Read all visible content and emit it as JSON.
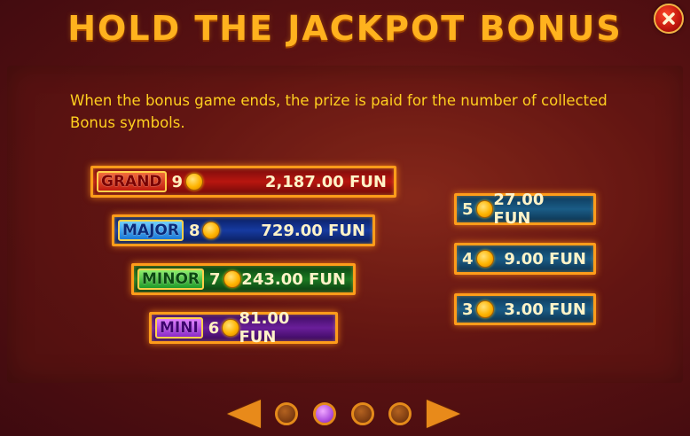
{
  "title": "HOLD THE JACKPOT BONUS",
  "description": "When the bonus game ends, the prize is paid for the number of collected Bonus symbols.",
  "close_icon": "close-x-icon",
  "jackpot_rows": [
    {
      "badge": "GRAND",
      "count": "9",
      "prize": "2,187.00 FUN"
    },
    {
      "badge": "MAJOR",
      "count": "8",
      "prize": "729.00 FUN"
    },
    {
      "badge": "MINOR",
      "count": "7",
      "prize": "243.00 FUN"
    },
    {
      "badge": "MINI",
      "count": "6",
      "prize": "81.00 FUN"
    }
  ],
  "plain_rows": [
    {
      "count": "5",
      "prize": "27.00 FUN"
    },
    {
      "count": "4",
      "prize": "9.00 FUN"
    },
    {
      "count": "3",
      "prize": "3.00 FUN"
    }
  ],
  "pagination": {
    "page_count": 4,
    "active_page": 2
  },
  "colors": {
    "title": "#ffb21e",
    "description": "#ffcf1f",
    "row_border": "#ff9c1a",
    "active_dot": "#b050e0"
  }
}
